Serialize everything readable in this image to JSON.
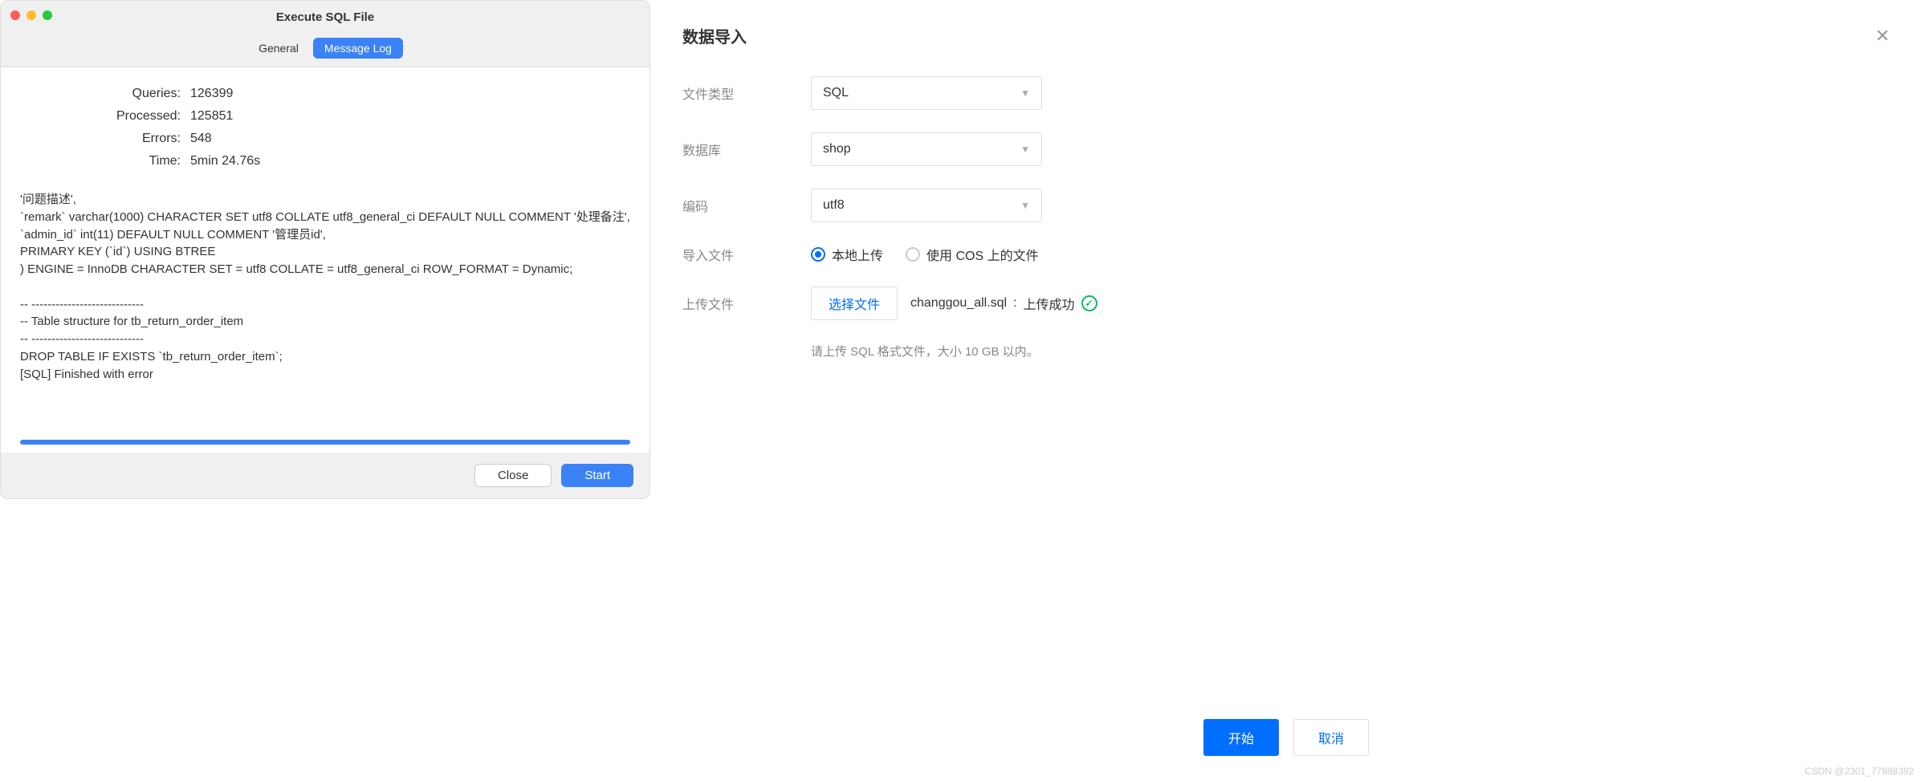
{
  "left": {
    "window_title": "Execute SQL File",
    "tabs": {
      "general": "General",
      "message_log": "Message Log"
    },
    "stats": {
      "queries_label": "Queries:",
      "queries_value": "126399",
      "processed_label": "Processed:",
      "processed_value": "125851",
      "errors_label": "Errors:",
      "errors_value": "548",
      "time_label": "Time:",
      "time_value": "5min 24.76s"
    },
    "log": "'问题描述',\n  `remark` varchar(1000) CHARACTER SET utf8 COLLATE utf8_general_ci DEFAULT NULL COMMENT '处理备注',\n  `admin_id` int(11) DEFAULT NULL COMMENT '管理员id',\n  PRIMARY KEY (`id`) USING BTREE\n) ENGINE = InnoDB CHARACTER SET = utf8 COLLATE = utf8_general_ci ROW_FORMAT = Dynamic;\n\n-- ----------------------------\n-- Table structure for tb_return_order_item\n-- ----------------------------\nDROP TABLE IF EXISTS `tb_return_order_item`;\n[SQL] Finished with error",
    "buttons": {
      "close": "Close",
      "start": "Start"
    }
  },
  "right": {
    "title": "数据导入",
    "labels": {
      "file_type": "文件类型",
      "database": "数据库",
      "encoding": "编码",
      "import_file": "导入文件",
      "upload_file": "上传文件"
    },
    "selects": {
      "file_type": "SQL",
      "database": "shop",
      "encoding": "utf8"
    },
    "radios": {
      "local": "本地上传",
      "cos": "使用 COS 上的文件"
    },
    "file_button": "选择文件",
    "file_name": "changgou_all.sql",
    "file_status_sep": " : ",
    "file_status": "上传成功",
    "hint": "请上传 SQL 格式文件，大小 10 GB 以内。",
    "buttons": {
      "start": "开始",
      "cancel": "取消"
    }
  },
  "watermark": "CSDN @2301_77888392"
}
